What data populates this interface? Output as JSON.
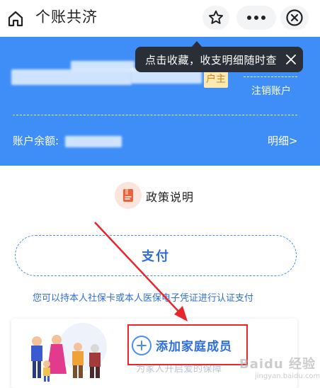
{
  "header": {
    "title": "个账共济"
  },
  "tooltip": {
    "text": "点击收藏，收支明细随时查"
  },
  "account": {
    "owner_badge": "户主",
    "cancel_link": "注销账户",
    "balance_label": "账户余额:",
    "detail_link": "明细>"
  },
  "policy": {
    "label": "政策说明"
  },
  "pay": {
    "label": "支付",
    "hint": "您可以持本人社保卡或本人医保电子凭证进行认证支付"
  },
  "family": {
    "add_label": "添加家庭成员",
    "subtitle": "为家人开启爱的保障"
  },
  "watermark": {
    "text": "Baidu 经验",
    "sub": "jingyan.baidu.com"
  },
  "colors": {
    "brand_blue": "#3f8ef7",
    "link_blue": "#2d6de0",
    "annotation_red": "#e8262b"
  }
}
